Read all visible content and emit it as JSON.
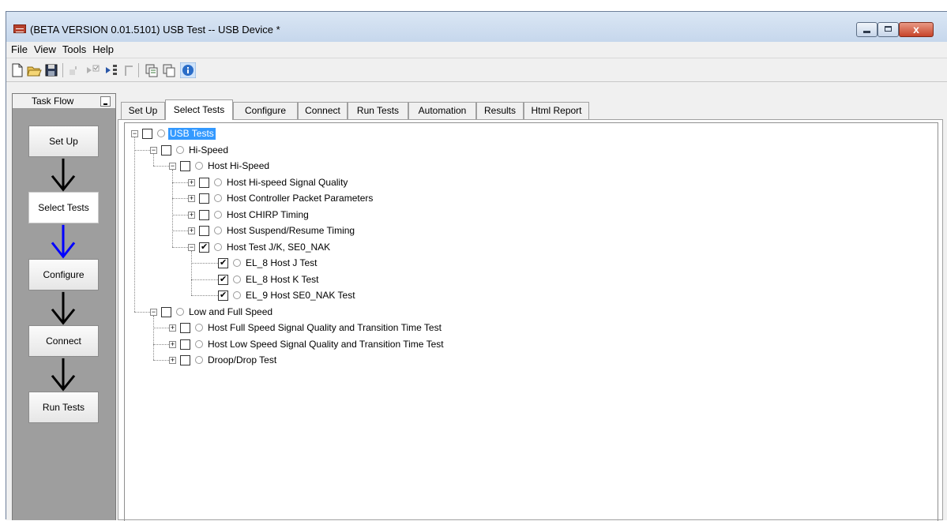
{
  "window": {
    "title": "(BETA VERSION 0.01.5101) USB Test -- USB Device *",
    "close_glyph": "x"
  },
  "menu": {
    "items": [
      {
        "label": "File"
      },
      {
        "label": "View"
      },
      {
        "label": "Tools"
      },
      {
        "label": "Help"
      }
    ]
  },
  "toolbar": {
    "icons": [
      "new-file-icon",
      "open-folder-icon",
      "save-icon",
      "run-icon",
      "run-selected-icon",
      "step-run-icon",
      "stop-icon",
      "copy-icon",
      "paste-icon",
      "info-icon"
    ]
  },
  "taskflow": {
    "title": "Task Flow",
    "steps": [
      {
        "label": "Set Up"
      },
      {
        "label": "Select Tests",
        "active": true
      },
      {
        "label": "Configure"
      },
      {
        "label": "Connect"
      },
      {
        "label": "Run Tests"
      }
    ],
    "arrow_colors": [
      "#000000",
      "#0000ff",
      "#000000",
      "#000000"
    ]
  },
  "tabs": [
    {
      "label": "Set Up"
    },
    {
      "label": "Select Tests",
      "selected": true
    },
    {
      "label": "Configure"
    },
    {
      "label": "Connect"
    },
    {
      "label": "Run Tests"
    },
    {
      "label": "Automation"
    },
    {
      "label": "Results"
    },
    {
      "label": "Html Report"
    }
  ],
  "tree": {
    "nodes": [
      {
        "label": "USB Tests",
        "level": 0,
        "expander": "minus",
        "checked": false,
        "selected": true
      },
      {
        "label": "Hi-Speed",
        "level": 1,
        "expander": "minus",
        "checked": false
      },
      {
        "label": "Host Hi-Speed",
        "level": 2,
        "expander": "minus",
        "checked": false
      },
      {
        "label": "Host Hi-speed Signal Quality",
        "level": 3,
        "expander": "plus",
        "checked": false
      },
      {
        "label": "Host Controller Packet Parameters",
        "level": 3,
        "expander": "plus",
        "checked": false
      },
      {
        "label": "Host CHIRP Timing",
        "level": 3,
        "expander": "plus",
        "checked": false
      },
      {
        "label": "Host Suspend/Resume Timing",
        "level": 3,
        "expander": "plus",
        "checked": false
      },
      {
        "label": "Host Test J/K, SE0_NAK",
        "level": 3,
        "expander": "minus",
        "checked": true
      },
      {
        "label": "EL_8 Host J Test",
        "level": 4,
        "expander": "",
        "checked": true
      },
      {
        "label": "EL_8 Host K Test",
        "level": 4,
        "expander": "",
        "checked": true
      },
      {
        "label": "EL_9 Host SE0_NAK Test",
        "level": 4,
        "expander": "",
        "checked": true
      },
      {
        "label": "Low and Full Speed",
        "level": 1,
        "expander": "minus",
        "checked": false
      },
      {
        "label": "Host Full Speed Signal Quality and Transition Time Test",
        "level": 2,
        "expander": "plus",
        "checked": false
      },
      {
        "label": "Host Low Speed Signal Quality and Transition Time Test",
        "level": 2,
        "expander": "plus",
        "checked": false
      },
      {
        "label": "Droop/Drop Test",
        "level": 2,
        "expander": "plus",
        "checked": false
      }
    ]
  }
}
